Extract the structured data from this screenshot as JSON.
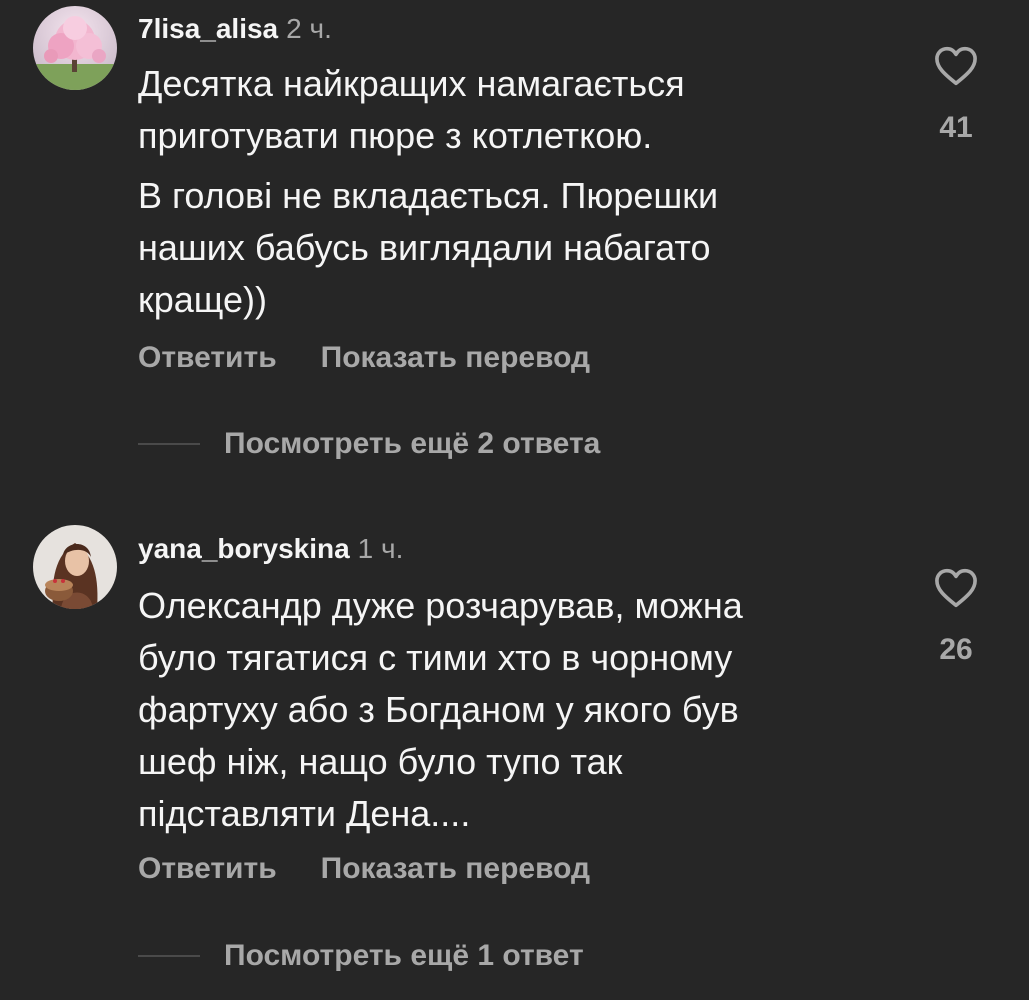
{
  "comments": [
    {
      "username": "7lisa_alisa",
      "time": "2 ч.",
      "paragraphs": [
        "Десятка найкращих намагається\nприготувати пюре з котлеткою.",
        "В голові не вкладається. Пюрешки\nнаших бабусь виглядали набагато\nкраще))"
      ],
      "reply_label": "Ответить",
      "translate_label": "Показать перевод",
      "view_replies_label": "Посмотреть ещё 2 ответа",
      "likes": "41",
      "avatar_icon": "cherry-blossom-tree-photo"
    },
    {
      "username": "yana_boryskina",
      "time": "1 ч.",
      "paragraphs": [
        "Олександр дуже розчарував, можна\nбуло тягатися с тими хто в чорному\nфартуху або з Богданом у якого був\nшеф ніж, нащо було тупо так\nпідставляти  Дена...."
      ],
      "reply_label": "Ответить",
      "translate_label": "Показать перевод",
      "view_replies_label": "Посмотреть ещё 1 ответ",
      "likes": "26",
      "avatar_icon": "woman-with-cake-photo"
    }
  ],
  "colors": {
    "background": "#262626",
    "primary_text": "#f5f5f5",
    "secondary_text": "#a8a8a8",
    "divider": "#4a4a4a"
  }
}
